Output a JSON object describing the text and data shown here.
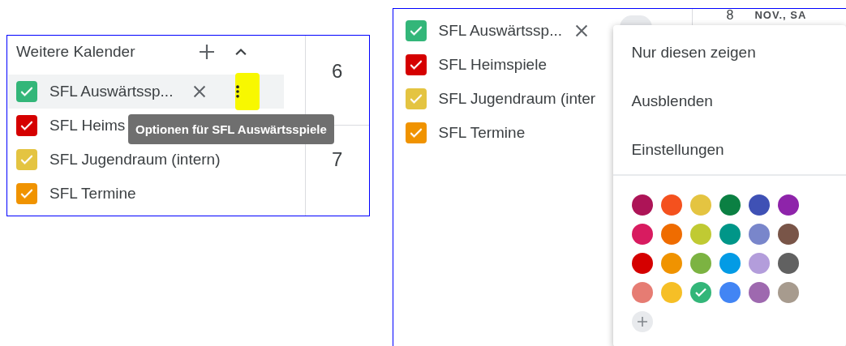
{
  "left_panel": {
    "section_title": "Weitere Kalender",
    "calendars": [
      {
        "name": "SFL Auswärtssp...",
        "color": "#33b679",
        "checked": true,
        "selected": true
      },
      {
        "name": "SFL Heims",
        "color": "#d50000",
        "checked": true,
        "selected": false
      },
      {
        "name": "SFL Jugendraum (intern)",
        "color": "#e4c441",
        "checked": true,
        "selected": false
      },
      {
        "name": "SFL Termine",
        "color": "#f09300",
        "checked": true,
        "selected": false
      }
    ],
    "tooltip": "Optionen für SFL Auswärtsspiele",
    "days": [
      "6",
      "7"
    ]
  },
  "right_panel": {
    "date_header": {
      "day": "8",
      "label": "NOV., SA"
    },
    "calendars": [
      {
        "name": "SFL Auswärtssp...",
        "color": "#33b679",
        "checked": true,
        "selected": true
      },
      {
        "name": "SFL Heimspiele",
        "color": "#d50000",
        "checked": true,
        "selected": false
      },
      {
        "name": "SFL Jugendraum (inter",
        "color": "#e4c441",
        "checked": true,
        "selected": false
      },
      {
        "name": "SFL Termine",
        "color": "#f09300",
        "checked": true,
        "selected": false
      }
    ],
    "menu": {
      "items": [
        "Nur diesen zeigen",
        "Ausblenden",
        "Einstellungen"
      ],
      "colors": [
        {
          "color": "#ad1457",
          "selected": false
        },
        {
          "color": "#f4511e",
          "selected": false
        },
        {
          "color": "#e4c441",
          "selected": false
        },
        {
          "color": "#0b8043",
          "selected": false
        },
        {
          "color": "#3f51b5",
          "selected": false
        },
        {
          "color": "#8e24aa",
          "selected": false
        },
        {
          "color": "#d81b60",
          "selected": false
        },
        {
          "color": "#ef6c00",
          "selected": false
        },
        {
          "color": "#c0ca33",
          "selected": false
        },
        {
          "color": "#009688",
          "selected": false
        },
        {
          "color": "#7986cb",
          "selected": false
        },
        {
          "color": "#795548",
          "selected": false
        },
        {
          "color": "#d50000",
          "selected": false
        },
        {
          "color": "#f09300",
          "selected": false
        },
        {
          "color": "#7cb342",
          "selected": false
        },
        {
          "color": "#039be5",
          "selected": false
        },
        {
          "color": "#b39ddb",
          "selected": false
        },
        {
          "color": "#616161",
          "selected": false
        },
        {
          "color": "#e67c73",
          "selected": false
        },
        {
          "color": "#f6bf26",
          "selected": false
        },
        {
          "color": "#33b679",
          "selected": true
        },
        {
          "color": "#4285f4",
          "selected": false
        },
        {
          "color": "#9e69af",
          "selected": false
        },
        {
          "color": "#a79b8e",
          "selected": false
        }
      ]
    }
  }
}
